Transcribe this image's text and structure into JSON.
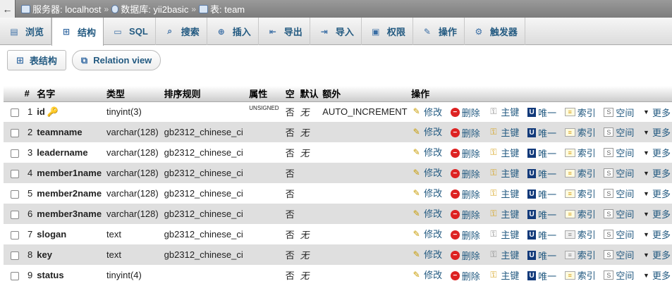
{
  "breadcrumb": {
    "back": "←",
    "server_label": "服务器: localhost",
    "db_label": "数据库: yii2basic",
    "table_label": "表: team",
    "sep": "»"
  },
  "tabs": [
    {
      "label": "浏览",
      "icon": "browse-icon",
      "glyph": "▤"
    },
    {
      "label": "结构",
      "icon": "structure-icon",
      "glyph": "⊞",
      "active": true
    },
    {
      "label": "SQL",
      "icon": "sql-icon",
      "glyph": "▭"
    },
    {
      "label": "搜索",
      "icon": "search-icon",
      "glyph": "⌕"
    },
    {
      "label": "插入",
      "icon": "insert-icon",
      "glyph": "⊕"
    },
    {
      "label": "导出",
      "icon": "export-icon",
      "glyph": "⇤"
    },
    {
      "label": "导入",
      "icon": "import-icon",
      "glyph": "⇥"
    },
    {
      "label": "权限",
      "icon": "privileges-icon",
      "glyph": "▣"
    },
    {
      "label": "操作",
      "icon": "operations-icon",
      "glyph": "✎"
    },
    {
      "label": "触发器",
      "icon": "triggers-icon",
      "glyph": "⚙"
    }
  ],
  "subnav": {
    "table_structure": "表结构",
    "relation_view": "Relation view"
  },
  "columns": [
    "#",
    "名字",
    "类型",
    "排序规则",
    "属性",
    "空",
    "默认",
    "额外",
    "操作"
  ],
  "actions": {
    "edit": "修改",
    "drop": "删除",
    "primary": "主键",
    "unique": "唯一",
    "index": "索引",
    "spatial": "空间",
    "more": "更多"
  },
  "rows": [
    {
      "num": "1",
      "name": "id",
      "type": "tinyint(3)",
      "collation": "",
      "attr": "UNSIGNED",
      "null": "否",
      "default": "无",
      "extra": "AUTO_INCREMENT",
      "is_pk": true
    },
    {
      "num": "2",
      "name": "teamname",
      "type": "varchar(128)",
      "collation": "gb2312_chinese_ci",
      "attr": "",
      "null": "否",
      "default": "无",
      "extra": ""
    },
    {
      "num": "3",
      "name": "leadername",
      "type": "varchar(128)",
      "collation": "gb2312_chinese_ci",
      "attr": "",
      "null": "否",
      "default": "无",
      "extra": ""
    },
    {
      "num": "4",
      "name": "member1name",
      "type": "varchar(128)",
      "collation": "gb2312_chinese_ci",
      "attr": "",
      "null": "否",
      "default": "",
      "extra": ""
    },
    {
      "num": "5",
      "name": "member2name",
      "type": "varchar(128)",
      "collation": "gb2312_chinese_ci",
      "attr": "",
      "null": "否",
      "default": "",
      "extra": ""
    },
    {
      "num": "6",
      "name": "member3name",
      "type": "varchar(128)",
      "collation": "gb2312_chinese_ci",
      "attr": "",
      "null": "否",
      "default": "",
      "extra": ""
    },
    {
      "num": "7",
      "name": "slogan",
      "type": "text",
      "collation": "gb2312_chinese_ci",
      "attr": "",
      "null": "否",
      "default": "无",
      "extra": "",
      "text_type": true
    },
    {
      "num": "8",
      "name": "key",
      "type": "text",
      "collation": "gb2312_chinese_ci",
      "attr": "",
      "null": "否",
      "default": "无",
      "extra": "",
      "text_type": true
    },
    {
      "num": "9",
      "name": "status",
      "type": "tinyint(4)",
      "collation": "",
      "attr": "",
      "null": "否",
      "default": "无",
      "extra": ""
    }
  ]
}
